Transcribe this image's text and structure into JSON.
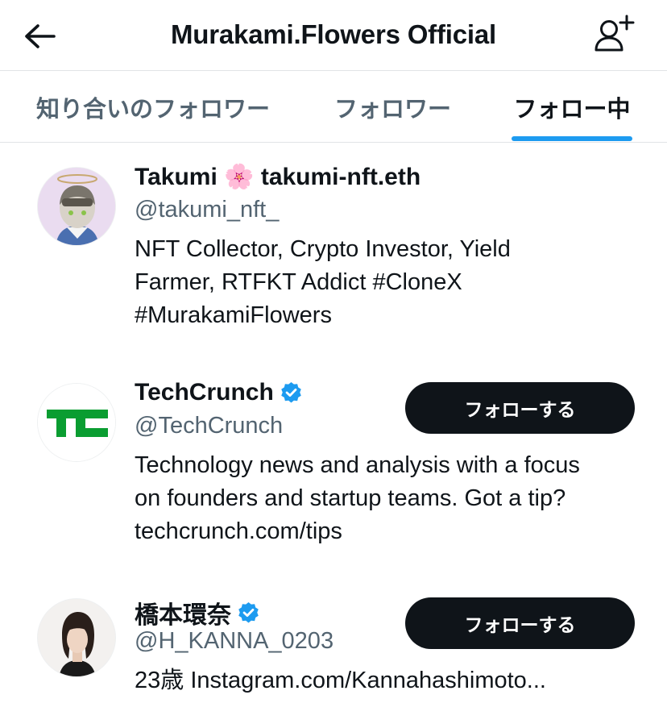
{
  "header": {
    "title": "Murakami.Flowers Official",
    "back_icon": "arrow-left-icon",
    "add_user_icon": "add-user-icon"
  },
  "tabs": [
    {
      "label": "知り合いのフォロワー",
      "active": false
    },
    {
      "label": "フォロワー",
      "active": false
    },
    {
      "label": "フォロー中",
      "active": true
    }
  ],
  "accent_color": "#1d9bf0",
  "users": [
    {
      "name": "Takumi 🌸 takumi-nft.eth",
      "handle": "@takumi_nft_",
      "verified": false,
      "bio_lines": [
        "NFT Collector, Crypto Investor, Yield",
        "Farmer, RTFKT Addict #CloneX",
        "#MurakamiFlowers"
      ],
      "follow_label": ""
    },
    {
      "name": "TechCrunch",
      "handle": "@TechCrunch",
      "verified": true,
      "bio_lines": [
        "Technology news and analysis with a focus",
        "on founders and startup teams. Got a tip?",
        "techcrunch.com/tips"
      ],
      "follow_label": "フォローする"
    },
    {
      "name": "橋本環奈",
      "handle": "@H_KANNA_0203",
      "verified": true,
      "bio_lines": [
        "23歳 Instagram.com/Kannahashimoto..."
      ],
      "follow_label": "フォローする"
    }
  ]
}
